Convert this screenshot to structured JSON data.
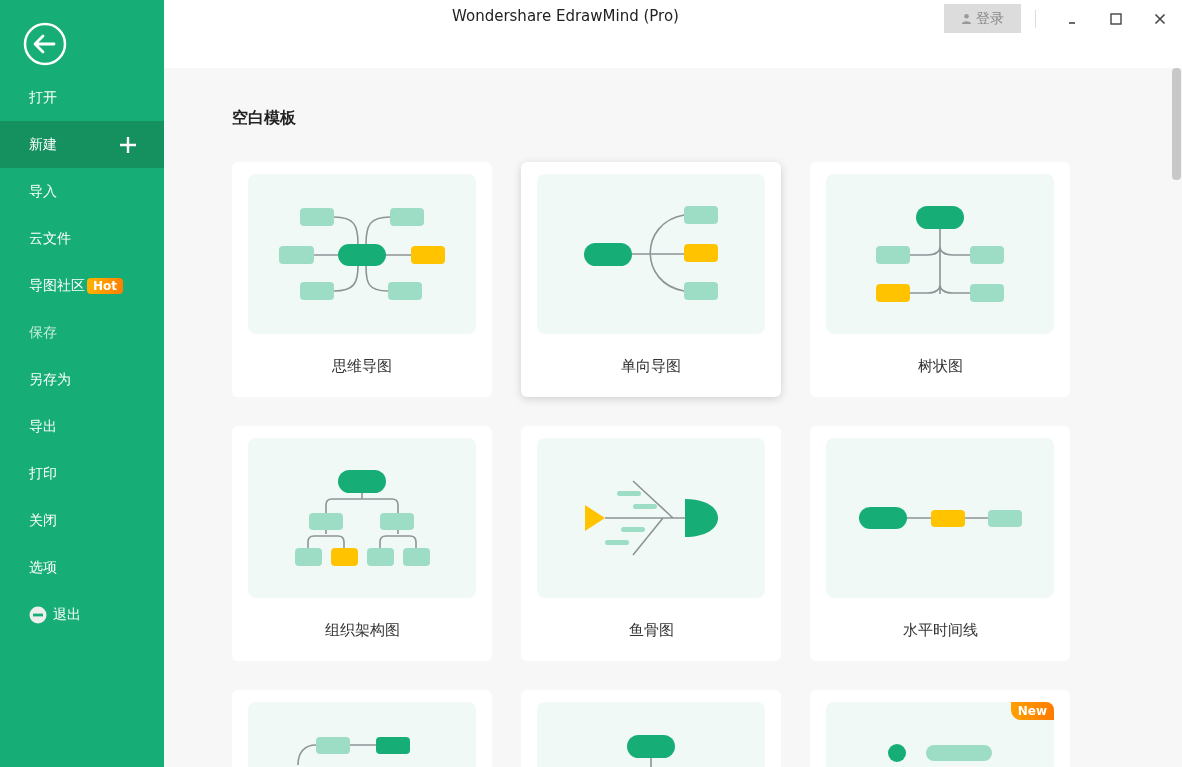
{
  "window": {
    "title": "Wondershare EdrawMind (Pro)",
    "login_button": "登录"
  },
  "sidebar": {
    "items": [
      {
        "kind": "item",
        "label": "打开",
        "selected": false,
        "disabled": false
      },
      {
        "kind": "item",
        "label": "新建",
        "selected": true,
        "disabled": false,
        "add": true
      },
      {
        "kind": "item",
        "label": "导入",
        "selected": false,
        "disabled": false
      },
      {
        "kind": "item",
        "label": "云文件",
        "selected": false,
        "disabled": false
      },
      {
        "kind": "item",
        "label": "导图社区",
        "selected": false,
        "disabled": false,
        "badge": "Hot"
      },
      {
        "kind": "item",
        "label": "保存",
        "selected": false,
        "disabled": true
      },
      {
        "kind": "item",
        "label": "另存为",
        "selected": false,
        "disabled": false
      },
      {
        "kind": "item",
        "label": "导出",
        "selected": false,
        "disabled": false
      },
      {
        "kind": "item",
        "label": "打印",
        "selected": false,
        "disabled": false
      },
      {
        "kind": "item",
        "label": "关闭",
        "selected": false,
        "disabled": false
      },
      {
        "kind": "item",
        "label": "选项",
        "selected": false,
        "disabled": false
      },
      {
        "kind": "exit",
        "label": "退出",
        "selected": false,
        "disabled": false
      }
    ]
  },
  "section_title": "空白模板",
  "templates": [
    {
      "kind": "mindmap",
      "label": "思维导图",
      "selected": false
    },
    {
      "kind": "rightmap",
      "label": "单向导图",
      "selected": true
    },
    {
      "kind": "tree",
      "label": "树状图",
      "selected": false
    },
    {
      "kind": "org",
      "label": "组织架构图",
      "selected": false
    },
    {
      "kind": "fishbone",
      "label": "鱼骨图",
      "selected": false
    },
    {
      "kind": "timeline",
      "label": "水平时间线",
      "selected": false
    },
    {
      "kind": "branch",
      "selected": false
    },
    {
      "kind": "vertical",
      "selected": false
    },
    {
      "kind": "dotlist",
      "selected": false,
      "badge": "New"
    }
  ]
}
